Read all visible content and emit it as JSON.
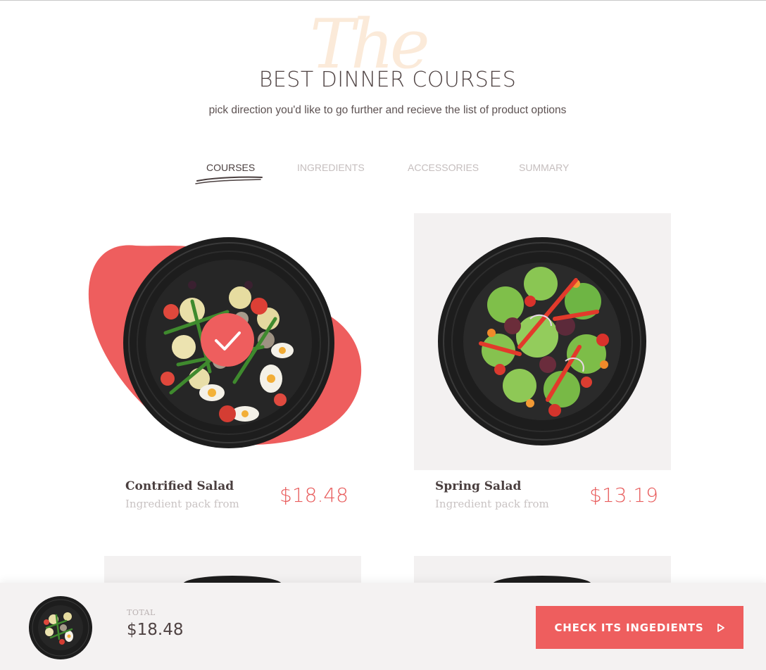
{
  "header": {
    "decor_script": "The",
    "title": "BEST DINNER COURSES",
    "subtitle": "pick direction you'd like to go further and recieve the list of product options"
  },
  "tabs": [
    {
      "label": "COURSES",
      "active": true
    },
    {
      "label": "INGREDIENTS",
      "active": false
    },
    {
      "label": "ACCESSORIES",
      "active": false
    },
    {
      "label": "SUMMARY",
      "active": false
    }
  ],
  "courses": [
    {
      "name": "Contrified Salad",
      "sub": "Ingredient pack from",
      "price": "$18.48",
      "selected": true
    },
    {
      "name": "Spring Salad",
      "sub": "Ingredient pack from",
      "price": "$13.19",
      "selected": false
    }
  ],
  "footer": {
    "total_label": "TOTAL",
    "total_value": "$18.48",
    "cta_label": "CHECK ITS INGEDIENTS",
    "cta_icon": "play-outline-icon"
  },
  "colors": {
    "accent": "#ee5e5e",
    "price": "#e85d5d",
    "card_bg": "#f3f1f1",
    "footer_bg": "#f4f2f2",
    "text_dark": "#4a3f3f",
    "text_muted": "#c5bebe"
  }
}
